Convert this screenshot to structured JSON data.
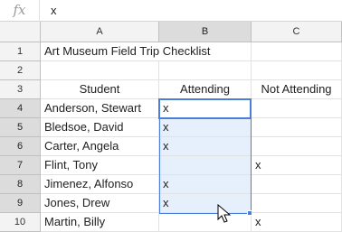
{
  "formula_bar": {
    "fx_label": "fx",
    "value": "x"
  },
  "columns": [
    "A",
    "B",
    "C"
  ],
  "rows": [
    {
      "n": "1",
      "a": "Art Museum Field Trip Checklist",
      "b": "",
      "c": ""
    },
    {
      "n": "2",
      "a": "",
      "b": "",
      "c": ""
    },
    {
      "n": "3",
      "a": "Student",
      "b": "Attending",
      "c": "Not Attending"
    },
    {
      "n": "4",
      "a": "Anderson, Stewart",
      "b": "x",
      "c": ""
    },
    {
      "n": "5",
      "a": "Bledsoe, David",
      "b": "x",
      "c": ""
    },
    {
      "n": "6",
      "a": "Carter, Angela",
      "b": "x",
      "c": ""
    },
    {
      "n": "7",
      "a": "Flint, Tony",
      "b": "",
      "c": "x"
    },
    {
      "n": "8",
      "a": "Jimenez, Alfonso",
      "b": "x",
      "c": ""
    },
    {
      "n": "9",
      "a": "Jones, Drew",
      "b": "x",
      "c": ""
    },
    {
      "n": "10",
      "a": "Martin, Billy",
      "b": "",
      "c": "x"
    }
  ],
  "colors": {
    "selection": "#4a7ed8",
    "selection_fill": "#e6effc",
    "header_bg": "#f3f3f3",
    "header_selected_bg": "#dcdcdc"
  }
}
